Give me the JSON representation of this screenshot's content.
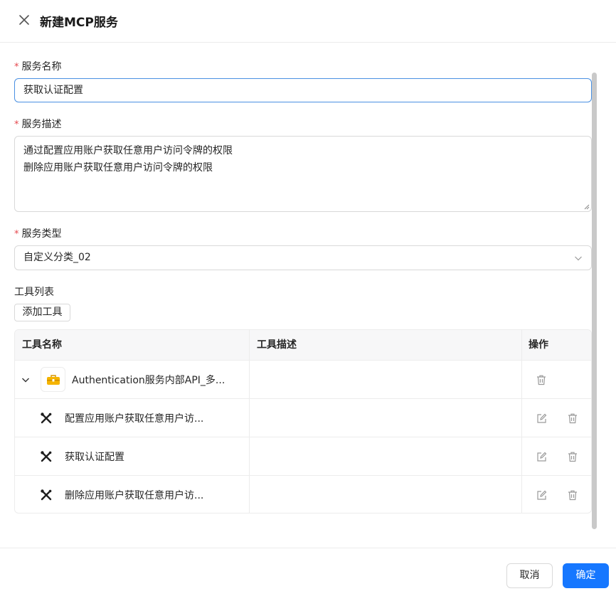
{
  "dialog": {
    "title": "新建MCP服务"
  },
  "form": {
    "name": {
      "label": "服务名称",
      "required_mark": "*",
      "value": "获取认证配置"
    },
    "description": {
      "label": "服务描述",
      "required_mark": "*",
      "lines": [
        "通过配置应用账户获取任意用户访问令牌的权限",
        "删除应用账户获取任意用户访问令牌的权限"
      ]
    },
    "type": {
      "label": "服务类型",
      "required_mark": "*",
      "value": "自定义分类_02"
    },
    "tools": {
      "label": "工具列表",
      "add_button": "添加工具",
      "columns": [
        "工具名称",
        "工具描述",
        "操作"
      ],
      "group": {
        "name": "Authentication服务内部API_多...",
        "description": ""
      },
      "items": [
        {
          "name": "配置应用账户获取任意用户访...",
          "description": ""
        },
        {
          "name": "获取认证配置",
          "description": ""
        },
        {
          "name": "删除应用账户获取任意用户访...",
          "description": ""
        }
      ]
    }
  },
  "footer": {
    "cancel": "取消",
    "confirm": "确定"
  },
  "colors": {
    "primary": "#1677ff",
    "required": "#e5484d",
    "focus_border": "#4a90e2",
    "toolbox_icon": "#f5b400"
  },
  "icons": {
    "close": "close-icon",
    "chevron": "chevron-down-icon",
    "expand": "chevron-down-icon",
    "toolbox": "toolbox-icon",
    "tool": "wrench-screwdriver-icon",
    "edit": "edit-icon",
    "delete": "trash-icon"
  }
}
